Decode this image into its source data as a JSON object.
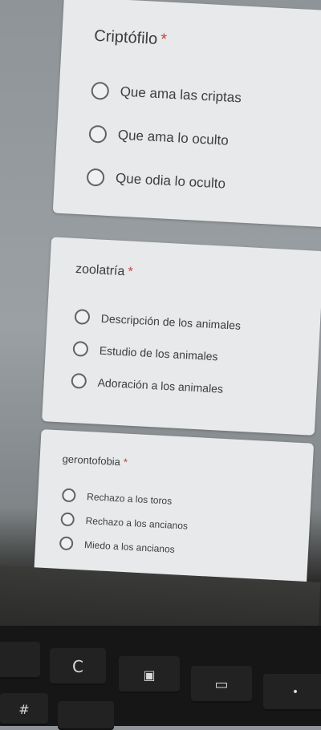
{
  "questions": [
    {
      "title": "Criptófilo",
      "required_mark": "*",
      "options": [
        "Que ama las criptas",
        "Que ama lo oculto",
        "Que odia lo oculto"
      ]
    },
    {
      "title": "zoolatría",
      "required_mark": "*",
      "options": [
        "Descripción de los animales",
        "Estudio de los animales",
        "Adoración a los animales"
      ]
    },
    {
      "title": "gerontofobia",
      "required_mark": "*",
      "options": [
        "Rechazo a los toros",
        "Rechazo a los ancianos",
        "Miedo a los ancianos"
      ]
    }
  ],
  "keyboard": {
    "keys": [
      "C",
      "▣",
      "▭",
      "#",
      "•"
    ]
  },
  "colors": {
    "card_bg": "#e7e9ea",
    "required": "#c8423a",
    "text": "#3a3d40"
  }
}
